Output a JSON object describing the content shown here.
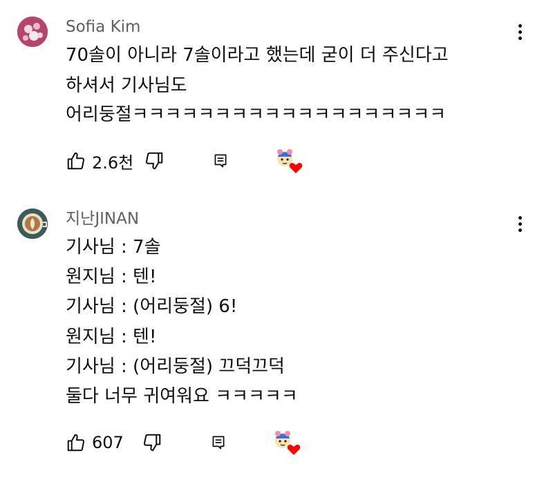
{
  "comments": [
    {
      "author": "Sofia Kim",
      "lines": [
        "70솔이 아니라 7솔이라고 했는데 굳이 더 주신다고",
        "하셔서 기사님도",
        "어리둥절ㅋㅋㅋㅋㅋㅋㅋㅋㅋㅋㅋㅋㅋㅋㅋㅋㅋㅋㅋ"
      ],
      "like_count": "2.6천",
      "avatar_colors": {
        "bg": "#b5456e",
        "fg": "#f4d9e3"
      }
    },
    {
      "author": "지난JINAN",
      "lines": [
        "기사님 : 7솔",
        "원지님 : 텐!",
        "기사님 : (어리둥절) 6!",
        "원지님 : 텐!",
        "기사님 : (어리둥절) 끄덕끄덕",
        "둘다 너무 귀여워요 ㅋㅋㅋㅋㅋ"
      ],
      "like_count": "607",
      "avatar_colors": {
        "bg": "#3f5b55",
        "fg": "#d9c39a"
      }
    }
  ],
  "icons": {
    "like": "thumbs-up-icon",
    "dislike": "thumbs-down-icon",
    "reply": "reply-comment-icon",
    "creator_heart": "creator-heart-icon",
    "more": "vertical-dots-icon"
  },
  "colors": {
    "text": "#0f0f0f",
    "author": "#606060",
    "heart": "#ff0000"
  }
}
